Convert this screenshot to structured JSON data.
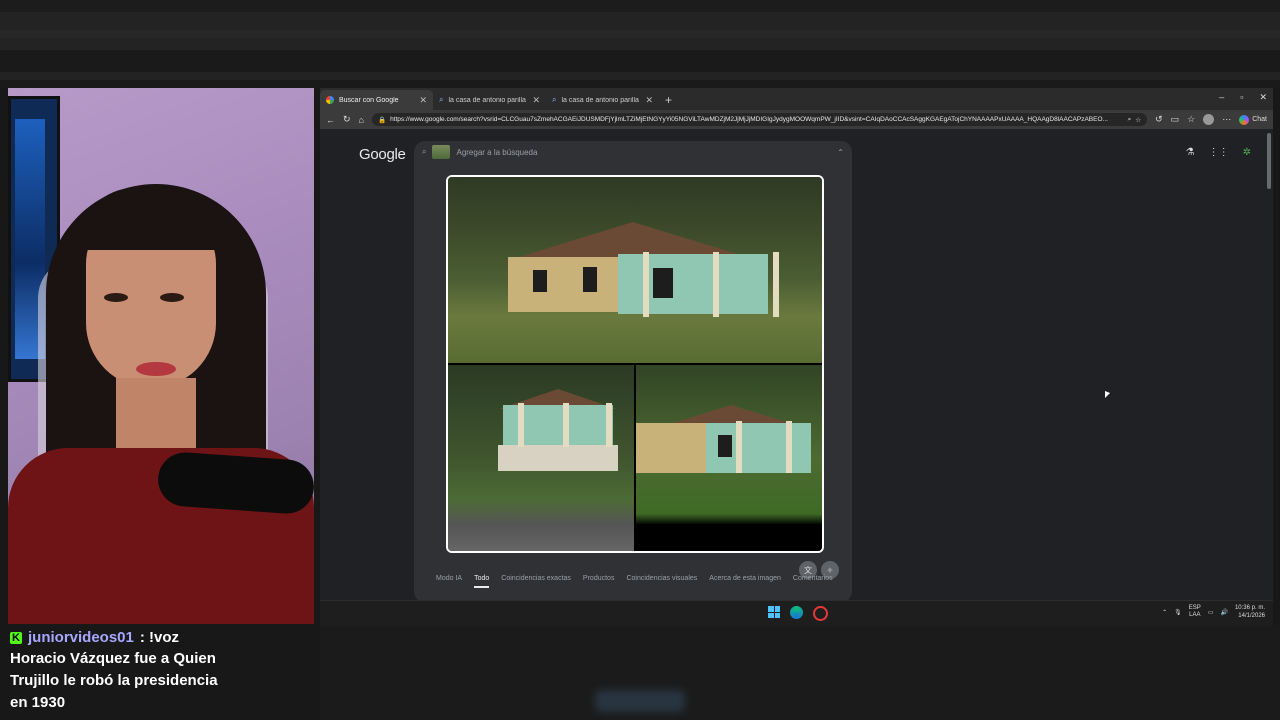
{
  "browser": {
    "tabs": [
      {
        "label": "Buscar con Google",
        "active": true,
        "icon": "google-icon"
      },
      {
        "label": "la casa de antonio parilla castillo",
        "active": false,
        "icon": "search-icon"
      },
      {
        "label": "la casa de antonio parilla antes de",
        "active": false,
        "icon": "search-icon"
      }
    ],
    "new_tab": "+",
    "window_controls": {
      "minimize": "–",
      "restore": "▫",
      "close": "✕"
    },
    "url": "https://www.google.com/search?vsrid=CLCGuau7sZmehACGAEiJDUSMDFjYjlmLTZiMjEtNGYyYi05NGViLTAwMDZjM2JjMjJjMDIGIgJydygMOOWqmPW_jIID&vsint=CAIqDAoCCAcSAggKGAEgATojChYNAAAAPxUAAAA_HQAAgD8lAACAPzABEO...",
    "chat_label": "Chat"
  },
  "google": {
    "logo": "Google",
    "search_placeholder": "Agregar a la búsqueda",
    "result_tabs": [
      "Modo IA",
      "Todo",
      "Coincidencias exactas",
      "Productos",
      "Coincidencias visuales",
      "Acerca de esta imagen",
      "Comentarios"
    ],
    "active_tab": "Todo"
  },
  "taskbar": {
    "lang_top": "ESP",
    "lang_bottom": "LAA",
    "time": "10:36 p. m.",
    "date": "14/1/2026"
  },
  "chat": {
    "username": "juniorvideos01",
    "command": ": !voz",
    "message": "Horacio Vázquez fue a Quien Trujillo le robó la presidencia en 1930"
  },
  "colors": {
    "kick_green": "#53fc18",
    "username_color": "#a8a7ff",
    "browser_bg": "#202124"
  }
}
